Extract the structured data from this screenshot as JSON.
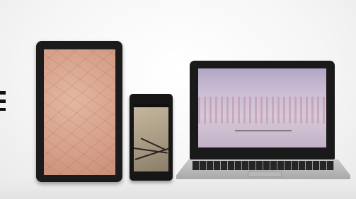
{
  "scene": {
    "devices": [
      {
        "kind": "tablet",
        "screen_content": "skin-microscopy-image"
      },
      {
        "kind": "smartphone",
        "screen_content": "hair-microscopy-image"
      },
      {
        "kind": "laptop",
        "screen_content": "skin-surface-microscopy-image"
      }
    ],
    "colors": {
      "background": "#f6f6f6",
      "device_body": "#1b1b1b",
      "tablet_screen": "#d6a08a",
      "laptop_screen": "#cbbdd3"
    }
  }
}
